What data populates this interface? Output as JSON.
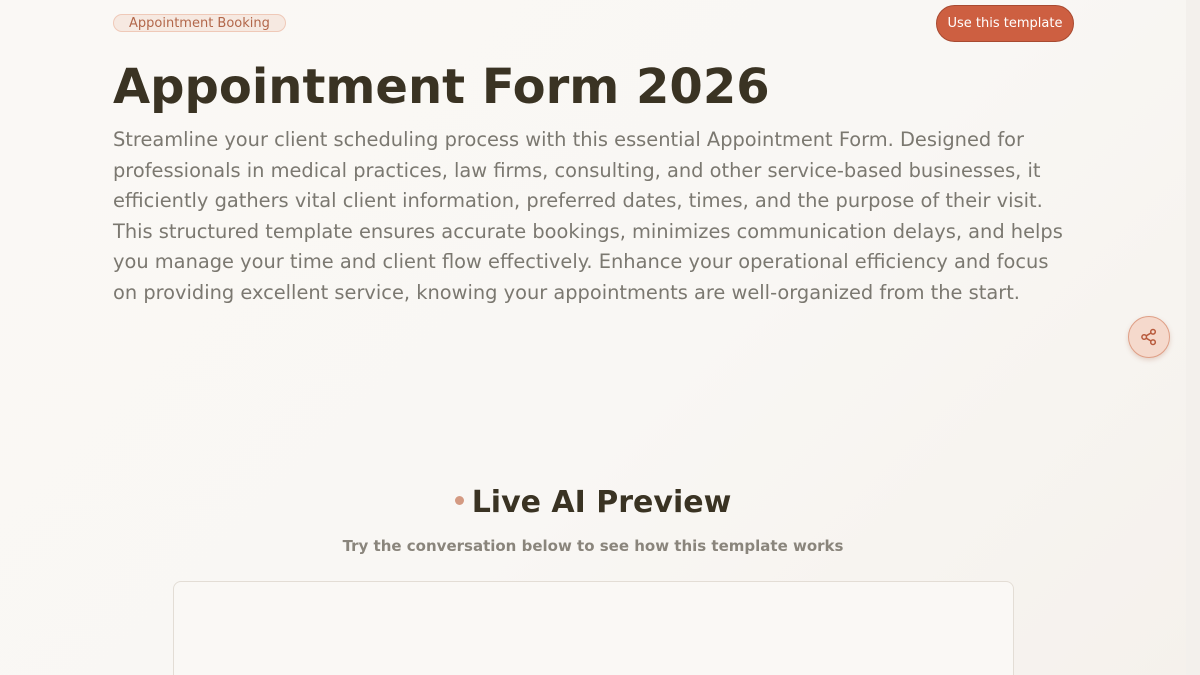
{
  "header": {
    "tag": "Appointment Booking",
    "use_template_label": "Use this template",
    "title": "Appointment Form 2026",
    "description": "Streamline your client scheduling process with this essential Appointment Form. Designed for professionals in medical practices, law firms, consulting, and other service-based businesses, it efficiently gathers vital client information, preferred dates, times, and the purpose of their visit. This structured template ensures accurate bookings, minimizes communication delays, and helps you manage your time and client flow effectively. Enhance your operational efficiency and focus on providing excellent service, knowing your appointments are well-organized from the start."
  },
  "share": {
    "icon": "share-icon"
  },
  "preview": {
    "title": "Live AI Preview",
    "subtitle": "Try the conversation below to see how this template works"
  },
  "colors": {
    "accent": "#cd5f41",
    "heading": "#3a3323",
    "body_text": "#7b7870",
    "background": "#f9f7f4"
  }
}
